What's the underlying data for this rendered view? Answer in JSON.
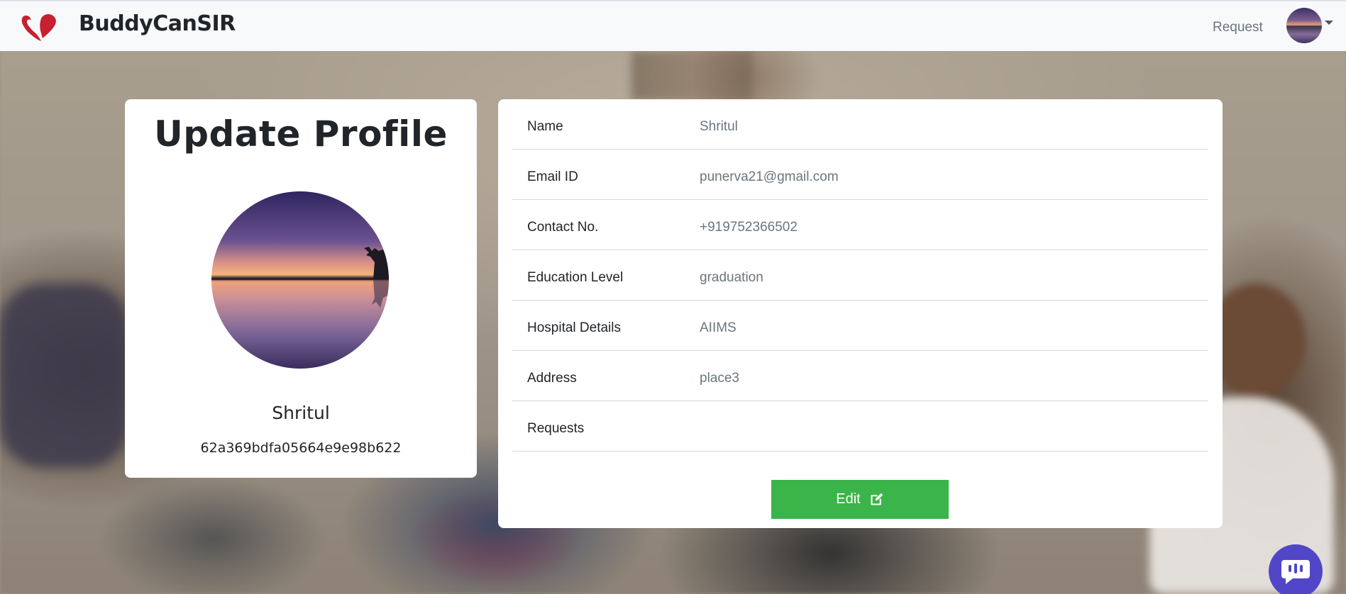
{
  "navbar": {
    "brand_name": "BuddyCanSIR",
    "request_link": "Request"
  },
  "profile": {
    "title": "Update Profile",
    "name": "Shritul",
    "id": "62a369bdfa05664e9e98b622"
  },
  "details": {
    "rows": [
      {
        "label": "Name",
        "value": "Shritul"
      },
      {
        "label": "Email ID",
        "value": "punerva21@gmail.com"
      },
      {
        "label": "Contact No.",
        "value": "+919752366502"
      },
      {
        "label": "Education Level",
        "value": "graduation"
      },
      {
        "label": "Hospital Details",
        "value": "AIIMS"
      },
      {
        "label": "Address",
        "value": "place3"
      },
      {
        "label": "Requests",
        "value": ""
      }
    ],
    "edit_label": "Edit"
  },
  "colors": {
    "edit_button": "#3bb54a",
    "chat_widget": "#5146c8",
    "logo": "#c8202f"
  },
  "icons": {
    "logo": "heart-hands-icon",
    "edit": "edit-icon",
    "chat": "chat-icon",
    "caret": "caret-down-icon"
  }
}
